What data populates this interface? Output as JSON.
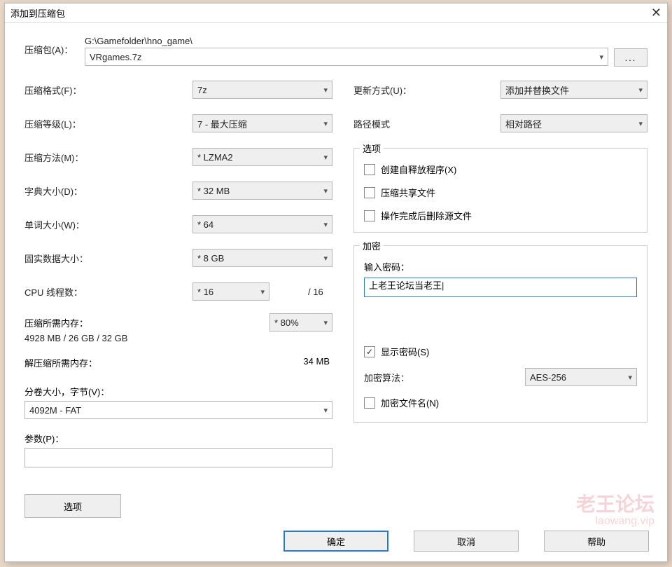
{
  "title": "添加到压缩包",
  "archive": {
    "label": "压缩包(A)：",
    "path_dir": "G:\\Gamefolder\\hno_game\\",
    "filename": "VRgames.7z",
    "browse": "..."
  },
  "left": {
    "format_label": "压缩格式(F)：",
    "format_value": "7z",
    "level_label": "压缩等级(L)：",
    "level_value": "7 - 最大压缩",
    "method_label": "压缩方法(M)：",
    "method_value": "* LZMA2",
    "dict_label": "字典大小(D)：",
    "dict_value": "* 32 MB",
    "word_label": "单词大小(W)：",
    "word_value": "* 64",
    "solid_label": "固实数据大小：",
    "solid_value": "* 8 GB",
    "cpu_label": "CPU 线程数：",
    "cpu_value": "* 16",
    "cpu_total": "/ 16",
    "mem_compress_label": "压缩所需内存：",
    "mem_compress_value": "4928 MB / 26 GB / 32 GB",
    "mem_percent": "* 80%",
    "mem_decompress_label": "解压缩所需内存：",
    "mem_decompress_value": "34 MB",
    "volume_label": "分卷大小，字节(V)：",
    "volume_value": "4092M - FAT",
    "params_label": "参数(P)：",
    "options_btn": "选项"
  },
  "right": {
    "update_label": "更新方式(U)：",
    "update_value": "添加并替换文件",
    "path_mode_label": "路径模式",
    "path_mode_value": "相对路径",
    "options_legend": "选项",
    "sfx_label": "创建自释放程序(X)",
    "shared_label": "压缩共享文件",
    "delete_label": "操作完成后删除源文件",
    "enc_legend": "加密",
    "enc_password_label": "输入密码：",
    "enc_password_value": "上老王论坛当老王",
    "show_password_label": "显示密码(S)",
    "show_password_checked": true,
    "algo_label": "加密算法：",
    "algo_value": "AES-256",
    "encrypt_names_label": "加密文件名(N)"
  },
  "buttons": {
    "ok": "确定",
    "cancel": "取消",
    "help": "帮助"
  },
  "watermark": {
    "main": "老王论坛",
    "sub": "laowang.vip"
  }
}
